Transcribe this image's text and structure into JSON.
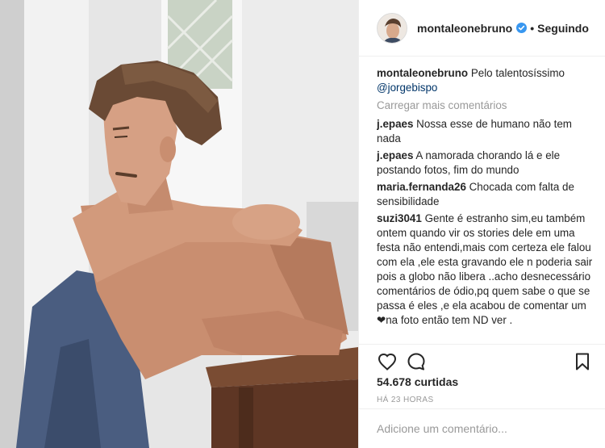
{
  "header": {
    "username": "montaleonebruno",
    "verified_icon": "verified-badge-icon",
    "separator": "•",
    "follow_status": "Seguindo"
  },
  "caption": {
    "author": "montaleonebruno",
    "text": "Pelo talentosíssimo",
    "mention": "@jorgebispo"
  },
  "load_more_label": "Carregar mais comentários",
  "comments": [
    {
      "author": "j.epaes",
      "text": "Nossa esse de humano não tem nada"
    },
    {
      "author": "j.epaes",
      "text": "A namorada chorando lá e ele postando fotos, fim do mundo"
    },
    {
      "author": "maria.fernanda26",
      "text": "Chocada com falta de sensibilidade"
    },
    {
      "author": "suzi3041",
      "text": "Gente é estranho sim,eu também ontem quando vir os stories dele em uma festa não entendi,mais com certeza ele falou com ela ,ele esta gravando ele n poderia sair pois a globo não libera ..acho desnecessário comentários de ódio,pq quem sabe o que se passa é eles ,e ela acabou de comentar um ❤na foto então tem ND ver ."
    }
  ],
  "actions": {
    "like_icon": "heart-outline-icon",
    "comment_icon": "comment-bubble-icon",
    "save_icon": "bookmark-icon"
  },
  "likes_text": "54.678 curtidas",
  "timestamp": "HÁ 23 HORAS",
  "add_comment": {
    "placeholder": "Adicione um comentário..."
  },
  "colors": {
    "text": "#262626",
    "muted": "#999999",
    "mention": "#003569",
    "verified": "#3897f0",
    "border": "#efefef"
  }
}
